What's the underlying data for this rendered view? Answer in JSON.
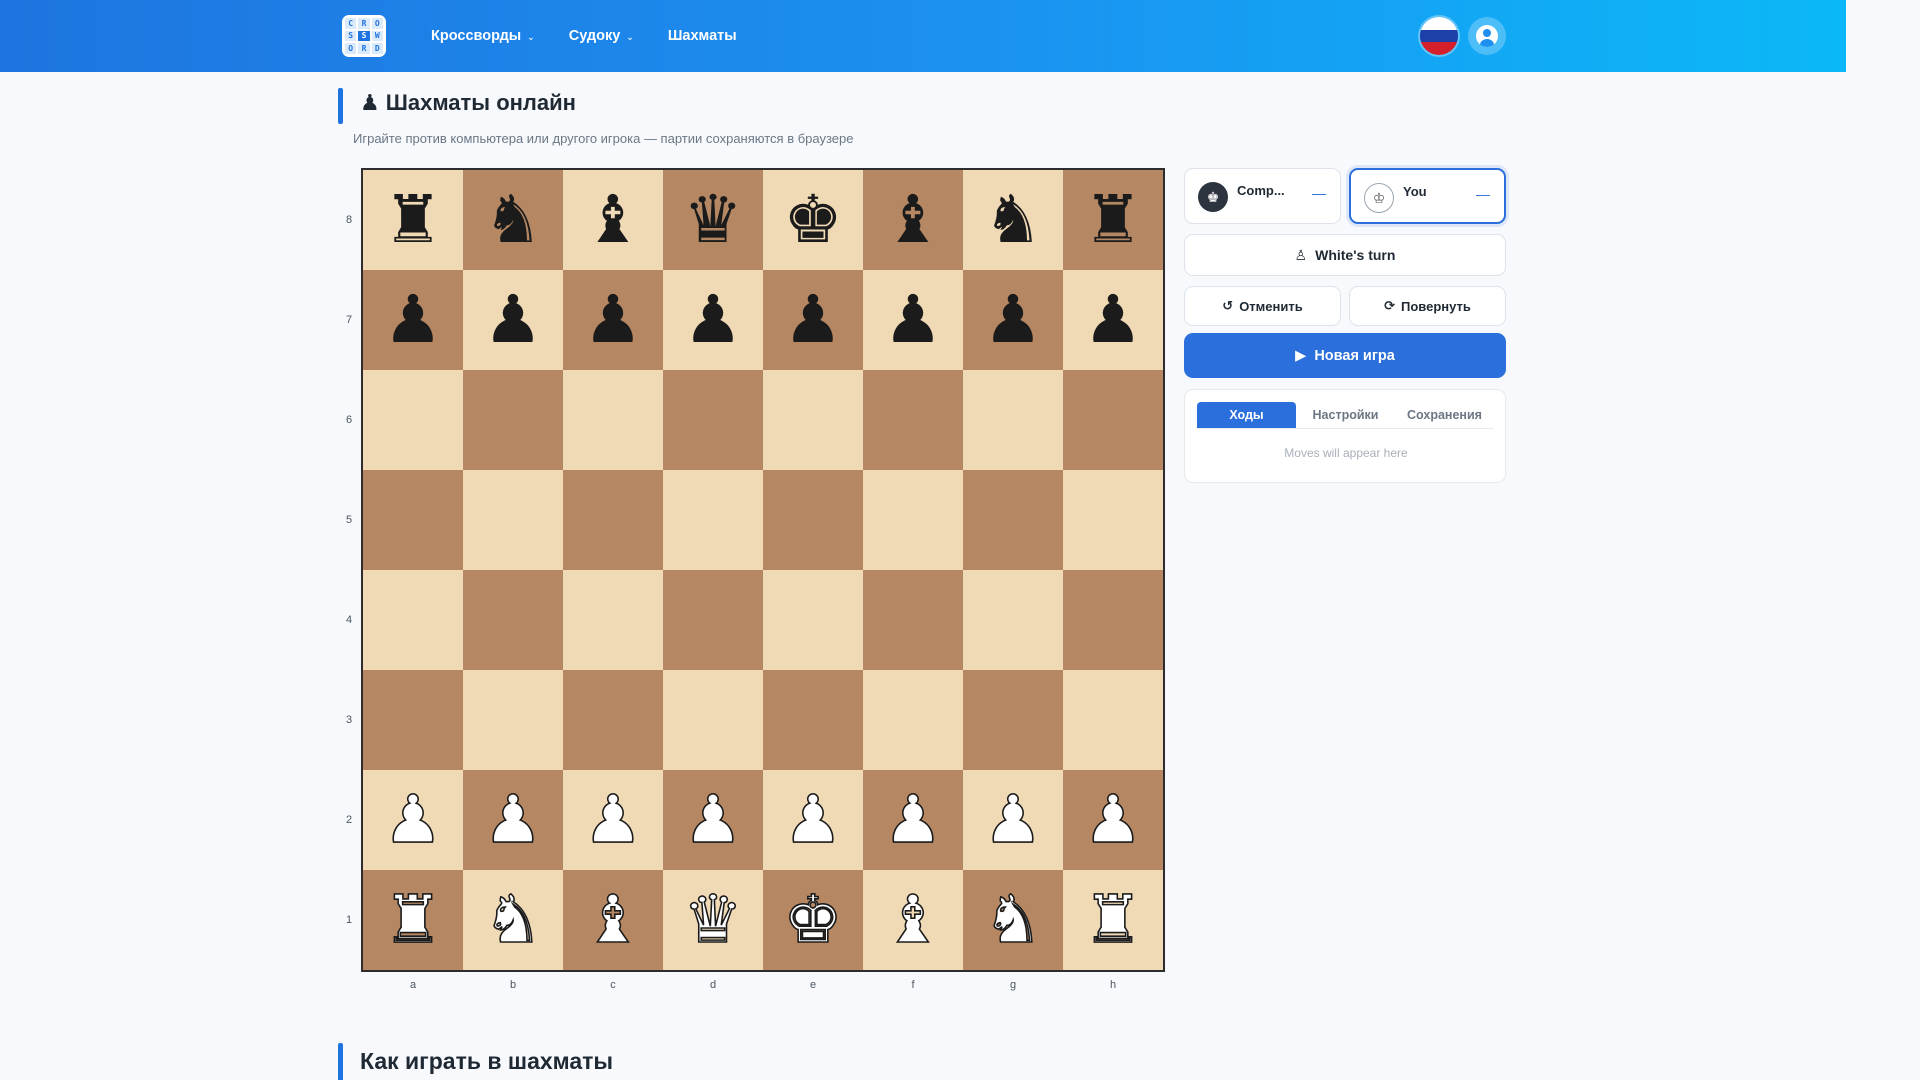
{
  "header": {
    "logo_letters": [
      "C",
      "R",
      "O",
      "S",
      "S",
      "W",
      "O",
      "R",
      "D"
    ],
    "nav": [
      {
        "label": "Кроссворды",
        "dropdown": true
      },
      {
        "label": "Судоку",
        "dropdown": true
      },
      {
        "label": "Шахматы",
        "dropdown": false
      }
    ],
    "language_flag": "ru",
    "user_icon": "user-circle-icon"
  },
  "page": {
    "title_icon": "♟",
    "title": "Шахматы онлайн",
    "subtitle": "Играйте против компьютера или другого игрока — партии сохраняются в браузере"
  },
  "board": {
    "ranks": [
      "8",
      "7",
      "6",
      "5",
      "4",
      "3",
      "2",
      "1"
    ],
    "files": [
      "a",
      "b",
      "c",
      "d",
      "e",
      "f",
      "g",
      "h"
    ],
    "position": [
      [
        "bR",
        "bN",
        "bB",
        "bQ",
        "bK",
        "bB",
        "bN",
        "bR"
      ],
      [
        "bP",
        "bP",
        "bP",
        "bP",
        "bP",
        "bP",
        "bP",
        "bP"
      ],
      [
        "",
        "",
        "",
        "",
        "",
        "",
        "",
        ""
      ],
      [
        "",
        "",
        "",
        "",
        "",
        "",
        "",
        ""
      ],
      [
        "",
        "",
        "",
        "",
        "",
        "",
        "",
        ""
      ],
      [
        "",
        "",
        "",
        "",
        "",
        "",
        "",
        ""
      ],
      [
        "wP",
        "wP",
        "wP",
        "wP",
        "wP",
        "wP",
        "wP",
        "wP"
      ],
      [
        "wR",
        "wN",
        "wB",
        "wQ",
        "wK",
        "wB",
        "wN",
        "wR"
      ]
    ],
    "colors": {
      "light": "#f0d9b5",
      "dark": "#b58863"
    }
  },
  "players": {
    "computer": {
      "name": "Comp...",
      "score": "—",
      "icon": "black-king-icon"
    },
    "you": {
      "name": "You",
      "score": "—",
      "icon": "white-king-icon"
    }
  },
  "status": {
    "turn_icon": "♙",
    "turn": "White's turn"
  },
  "actions": {
    "undo": {
      "icon": "↺",
      "label": "Отменить"
    },
    "flip": {
      "icon": "⟳",
      "label": "Повернуть"
    },
    "new_game": {
      "icon": "▶",
      "label": "Новая игра"
    }
  },
  "tabs": {
    "items": [
      "Ходы",
      "Настройки",
      "Сохранения"
    ],
    "active": 0,
    "moves_placeholder": "Moves will appear here"
  },
  "section": {
    "heading": "Как играть в шахматы"
  },
  "accent": "#2a6fdb"
}
